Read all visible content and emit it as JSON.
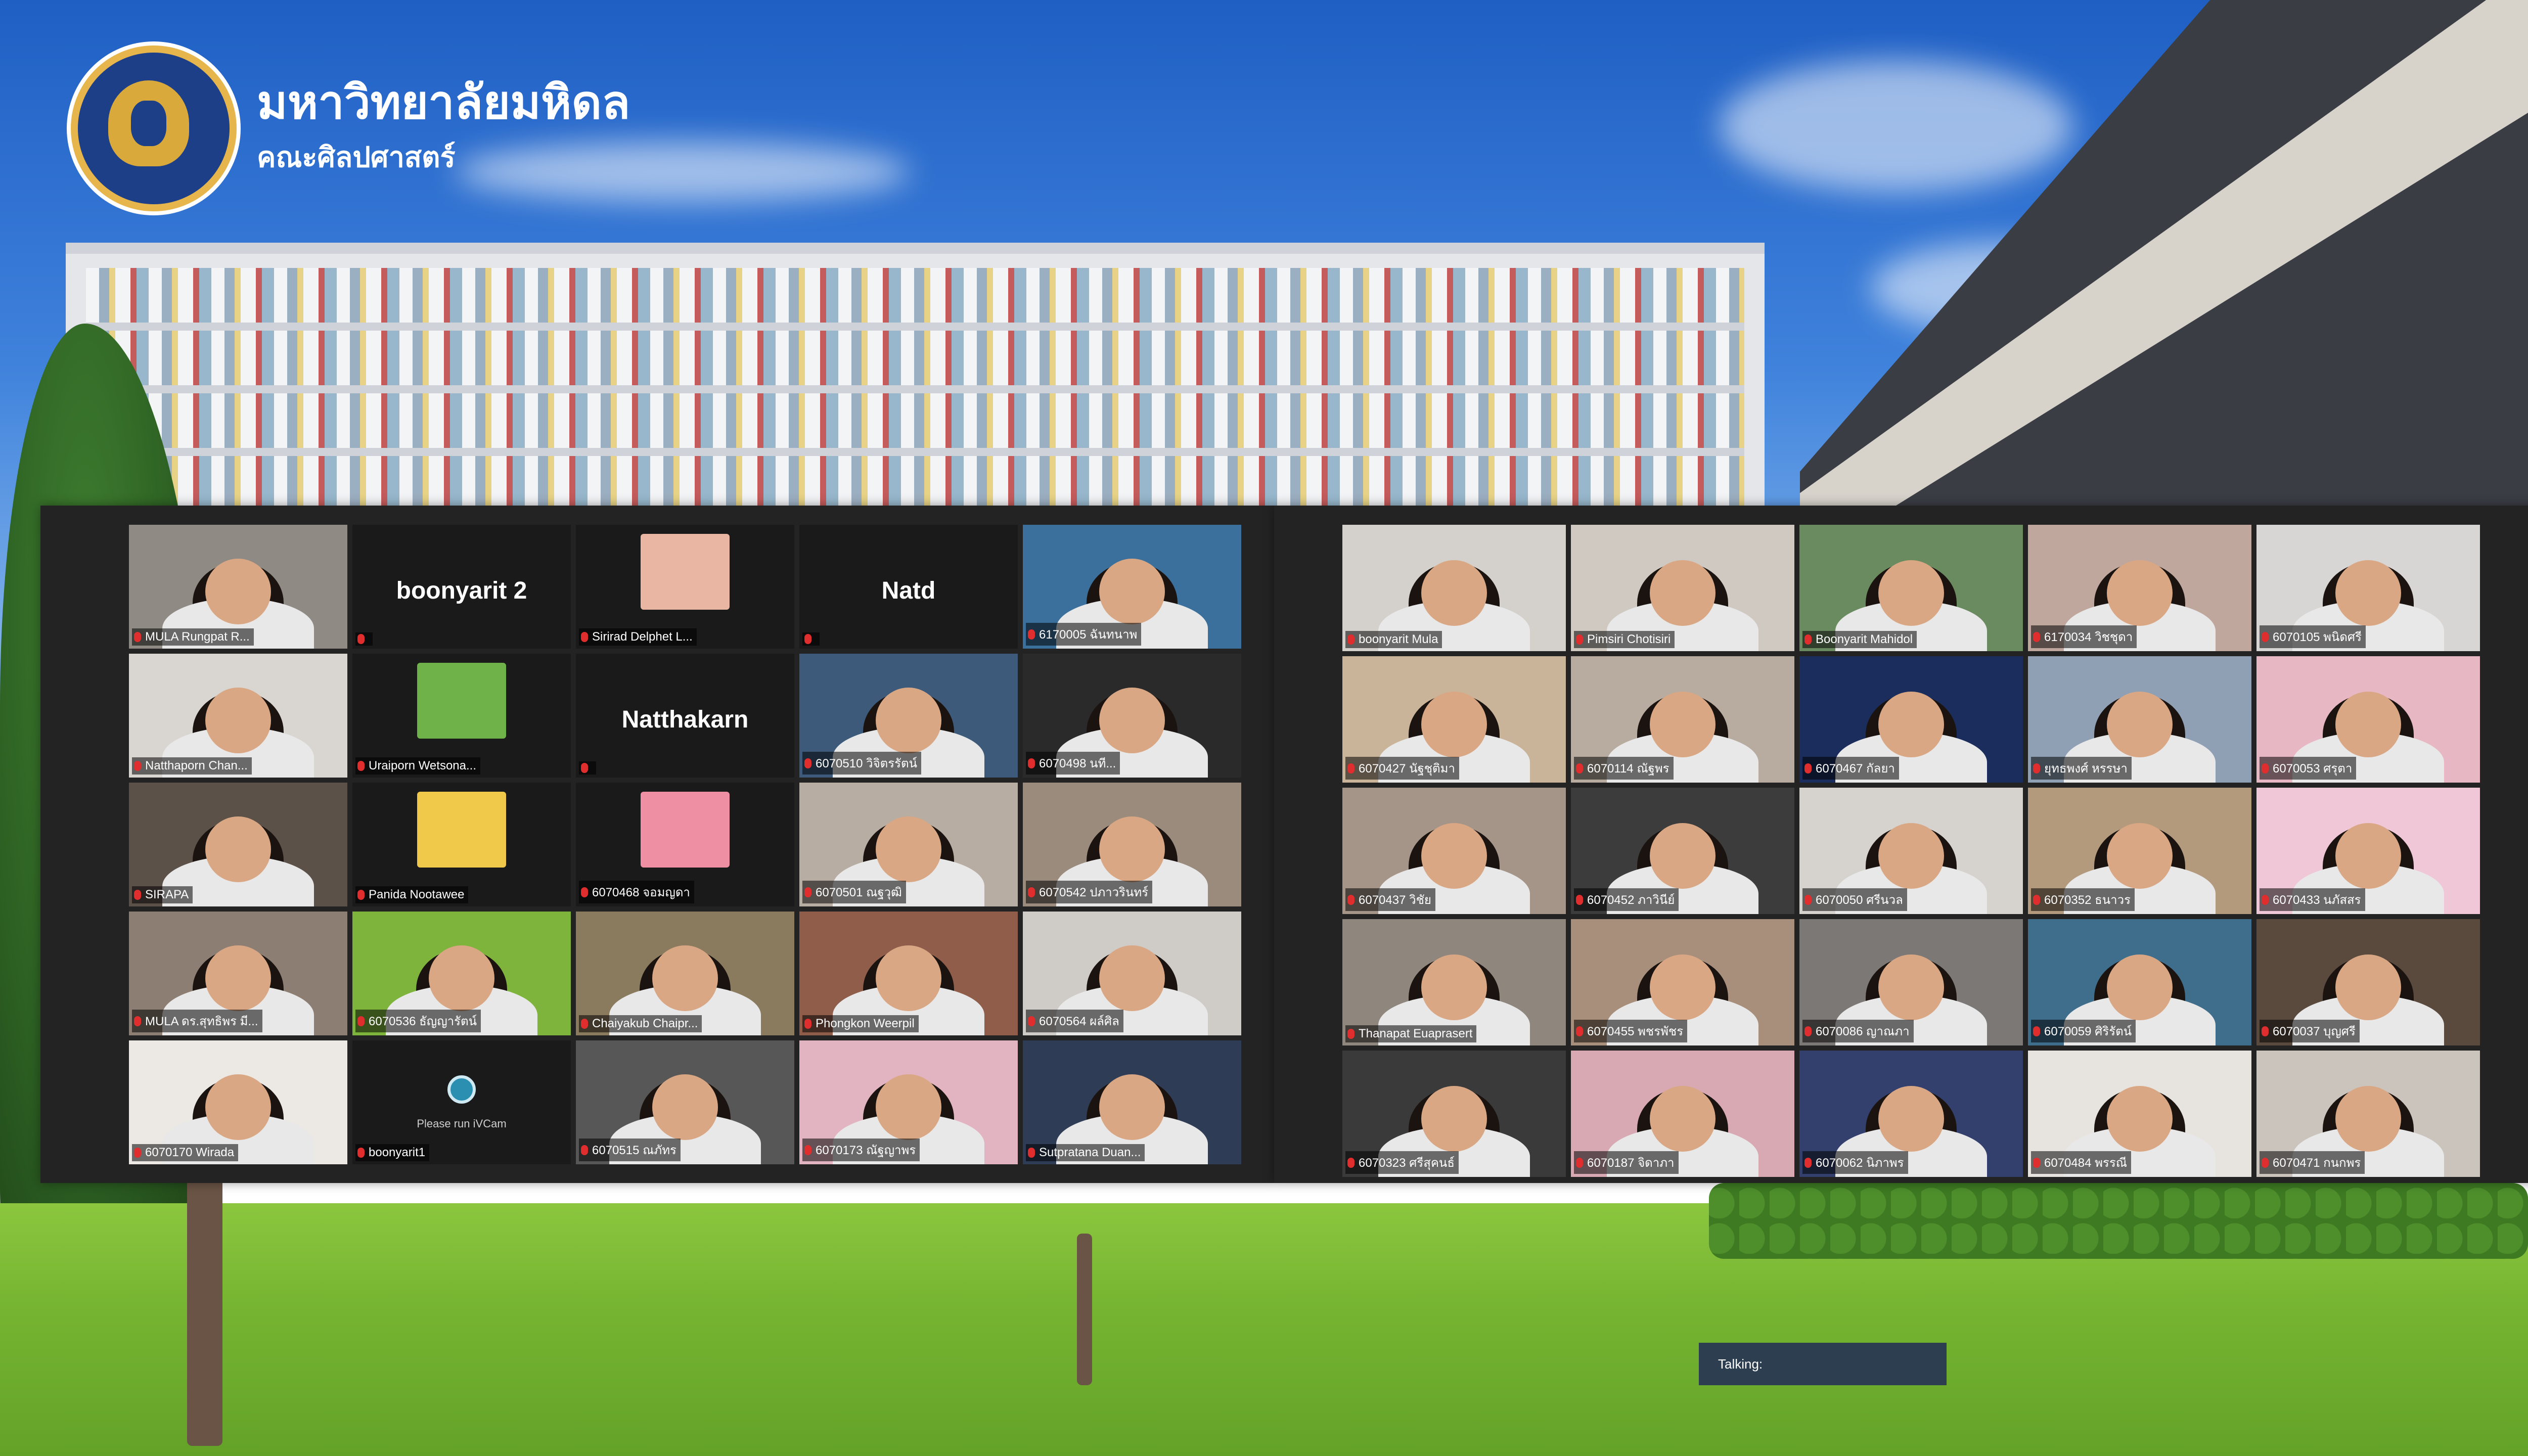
{
  "logo": {
    "title": "มหาวิทยาลัยมหิดล",
    "subtitle": "คณะศิลปศาสตร์",
    "seal_colors": {
      "ring": "#e6b64c",
      "field": "#1d3f87"
    }
  },
  "talking_indicator": "Talking:",
  "accent": {
    "active_speaker_border": "#b5d94a",
    "muted_mic": "#e02d2d"
  },
  "gallery_left": [
    {
      "name": "MULA Rungpat R...",
      "type": "video",
      "bg": "#8f8a84"
    },
    {
      "name": "",
      "type": "name",
      "big": "boonyarit 2"
    },
    {
      "name": "Sirirad Delphet L...",
      "type": "photo",
      "photo": "#e9b6a4"
    },
    {
      "name": "",
      "type": "name",
      "big": "Natd"
    },
    {
      "name": "6170005 ฉันทนาพ",
      "type": "video",
      "bg": "#3b6f9c",
      "active": true
    },
    {
      "name": "Natthaporn Chan...",
      "type": "video",
      "bg": "#d9d6d2"
    },
    {
      "name": "Uraiporn Wetsona...",
      "type": "photo",
      "photo": "#6fb24a"
    },
    {
      "name": "",
      "type": "name",
      "big": "Natthakarn"
    },
    {
      "name": "6070510 วิจิตรรัตน์",
      "type": "video",
      "bg": "#3d5a7a"
    },
    {
      "name": "6070498 นที...",
      "type": "video",
      "bg": "#2a2a2a"
    },
    {
      "name": "SIRAPA",
      "type": "video",
      "bg": "#5b5149"
    },
    {
      "name": "Panida Nootawee",
      "type": "photo",
      "photo": "#f1c94a"
    },
    {
      "name": "6070468 จอมญดา",
      "type": "photo",
      "photo": "#ee8fa3"
    },
    {
      "name": "6070501 ณฐวุฒิ",
      "type": "video",
      "bg": "#b8ada2"
    },
    {
      "name": "6070542 ปภาวรินทร์",
      "type": "video",
      "bg": "#9a8b7c"
    },
    {
      "name": "MULA ดร.สุทธิพร มี...",
      "type": "video",
      "bg": "#8c7e72"
    },
    {
      "name": "6070536 ธัญญารัตน์",
      "type": "video",
      "bg": "#7eb43c"
    },
    {
      "name": "Chaiyakub Chaipr...",
      "type": "video",
      "bg": "#8b7b5e"
    },
    {
      "name": "Phongkon Weerpil",
      "type": "video",
      "bg": "#8f5d4a"
    },
    {
      "name": "6070564 ผล์ศิล",
      "type": "video",
      "bg": "#cfcbc6"
    },
    {
      "name": "6070170 Wirada",
      "type": "video",
      "bg": "#ece9e4"
    },
    {
      "name": "boonyarit1",
      "type": "nocam",
      "big": "Please run iVCam"
    },
    {
      "name": "6070515 ณภัทร",
      "type": "video",
      "bg": "#575757"
    },
    {
      "name": "6070173 ณัฐญาพร",
      "type": "video",
      "bg": "#e2b3c1"
    },
    {
      "name": "Sutpratana Duan...",
      "type": "video",
      "bg": "#2f3c56"
    }
  ],
  "gallery_right": [
    {
      "name": "boonyarit Mula",
      "type": "video",
      "bg": "#d4d1cc"
    },
    {
      "name": "Pimsiri Chotisiri",
      "type": "video",
      "bg": "#cfc9c2"
    },
    {
      "name": "Boonyarit Mahidol",
      "type": "video",
      "bg": "#6a8a5f"
    },
    {
      "name": "6170034 วิชชุดา",
      "type": "video",
      "bg": "#bfa79e"
    },
    {
      "name": "6070105 พนิดศรี",
      "type": "video",
      "bg": "#d8d6d4"
    },
    {
      "name": "6070427 นัฐชุติมา",
      "type": "video",
      "bg": "#c9b49a"
    },
    {
      "name": "6070114 ณัฐพร",
      "type": "video",
      "bg": "#b8aba0"
    },
    {
      "name": "6070467 กัลยา",
      "type": "video",
      "bg": "#1b2d5c"
    },
    {
      "name": "ยุทธพงศ์ หรรษา",
      "type": "video",
      "bg": "#8fa0b5"
    },
    {
      "name": "6070053 ศรุตา",
      "type": "video",
      "bg": "#e8b7c4"
    },
    {
      "name": "6070437 วิชัย",
      "type": "video",
      "bg": "#a59488"
    },
    {
      "name": "6070452 ภาวินีย์",
      "type": "video",
      "bg": "#3c3c3c"
    },
    {
      "name": "6070050 ศรีนวล",
      "type": "video",
      "bg": "#d6d2ce"
    },
    {
      "name": "6070352 ธนาวร",
      "type": "video",
      "bg": "#b39a7c"
    },
    {
      "name": "6070433 นภัสสร",
      "type": "video",
      "bg": "#f0c7d6"
    },
    {
      "name": "Thanapat Euaprasert",
      "type": "video",
      "bg": "#8f877e"
    },
    {
      "name": "6070455 พชรพัชร",
      "type": "video",
      "bg": "#a88f7b"
    },
    {
      "name": "6070086 ญาณภา",
      "type": "video",
      "bg": "#7c7876"
    },
    {
      "name": "6070059 ศิริรัตน์",
      "type": "video",
      "bg": "#3f6d8c"
    },
    {
      "name": "6070037 บุญศรี",
      "type": "video",
      "bg": "#5a4a3e"
    },
    {
      "name": "6070323 ศรีสุคนธ์",
      "type": "video",
      "bg": "#3a3a3a"
    },
    {
      "name": "6070187 จิดาภา",
      "type": "video",
      "bg": "#d8a9b3"
    },
    {
      "name": "6070062 นิภาพร",
      "type": "video",
      "bg": "#33406e"
    },
    {
      "name": "6070484 พรรณี",
      "type": "video",
      "bg": "#e7e4e0"
    },
    {
      "name": "6070471 กนกพร",
      "type": "video",
      "bg": "#cbc4bc"
    }
  ]
}
